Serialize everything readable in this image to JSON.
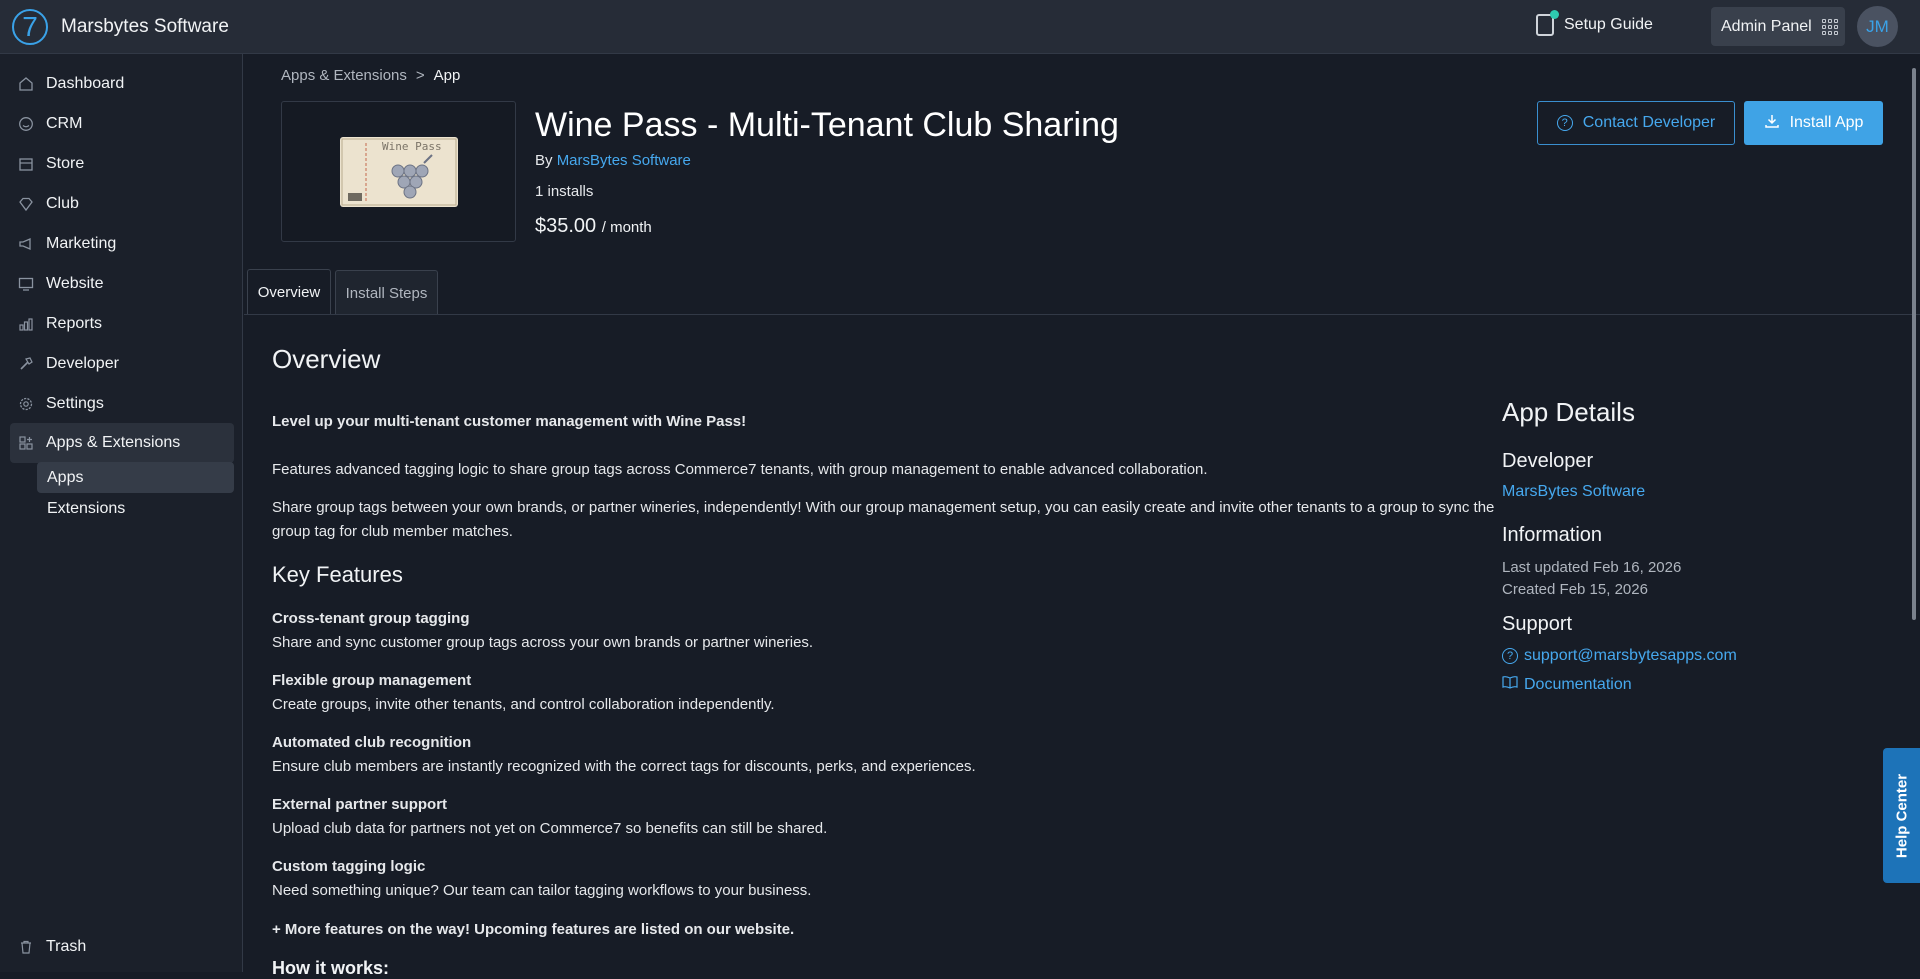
{
  "header": {
    "logo_glyph": "7",
    "brand": "Marsbytes Software",
    "setup_guide": "Setup Guide",
    "admin_panel": "Admin Panel",
    "avatar_initials": "JM"
  },
  "sidebar": {
    "items": [
      {
        "label": "Dashboard",
        "icon": "home-icon"
      },
      {
        "label": "CRM",
        "icon": "smile-icon"
      },
      {
        "label": "Store",
        "icon": "store-icon"
      },
      {
        "label": "Club",
        "icon": "diamond-icon"
      },
      {
        "label": "Marketing",
        "icon": "megaphone-icon"
      },
      {
        "label": "Website",
        "icon": "monitor-icon"
      },
      {
        "label": "Reports",
        "icon": "chart-icon"
      },
      {
        "label": "Developer",
        "icon": "hammer-icon"
      },
      {
        "label": "Settings",
        "icon": "gear-icon"
      },
      {
        "label": "Apps & Extensions",
        "icon": "apps-icon"
      }
    ],
    "sub_items": [
      "Apps",
      "Extensions"
    ],
    "trash": "Trash"
  },
  "breadcrumb": {
    "parent": "Apps & Extensions",
    "sep": ">",
    "current": "App"
  },
  "app": {
    "title": "Wine Pass - Multi-Tenant Club Sharing",
    "by_label": "By",
    "developer": "MarsBytes Software",
    "installs": "1 installs",
    "price": "$35.00",
    "price_period": "/ month",
    "ticket_text": "Wine Pass"
  },
  "actions": {
    "contact": "Contact Developer",
    "install": "Install App"
  },
  "tabs": {
    "overview": "Overview",
    "install_steps": "Install Steps"
  },
  "overview": {
    "heading": "Overview",
    "tagline": "Level up your multi-tenant customer management with Wine Pass!",
    "para1": "Features advanced tagging logic to share group tags across Commerce7 tenants, with group management to enable advanced collaboration.",
    "para2": "Share group tags between your own brands, or partner wineries, independently! With our group management setup, you can easily create and invite other tenants to a group to sync the group tag for club member matches.",
    "key_features_heading": "Key Features",
    "features": [
      {
        "title": "Cross-tenant group tagging",
        "desc": "Share and sync customer group tags across your own brands or partner wineries."
      },
      {
        "title": "Flexible group management",
        "desc": "Create groups, invite other tenants, and control collaboration independently."
      },
      {
        "title": "Automated club recognition",
        "desc": "Ensure club members are instantly recognized with the correct tags for discounts, perks, and experiences."
      },
      {
        "title": "External partner support",
        "desc": "Upload club data for partners not yet on Commerce7 so benefits can still be shared."
      },
      {
        "title": "Custom tagging logic",
        "desc": "Need something unique? Our team can tailor tagging workflows to your business."
      }
    ],
    "more": "+ More features on the way! Upcoming features are listed on our website.",
    "how_heading": "How it works:"
  },
  "details": {
    "heading": "App Details",
    "developer_heading": "Developer",
    "developer": "MarsBytes Software",
    "info_heading": "Information",
    "last_updated": "Last updated Feb 16, 2026",
    "created": "Created Feb 15, 2026",
    "support_heading": "Support",
    "support_email": "support@marsbytesapps.com",
    "documentation": "Documentation"
  },
  "help_center": "Help Center",
  "colors": {
    "accent": "#3fa3e6",
    "link": "#46a8ee",
    "background": "#171c26",
    "sidebar": "#1b202a",
    "topbar": "#262c37"
  }
}
